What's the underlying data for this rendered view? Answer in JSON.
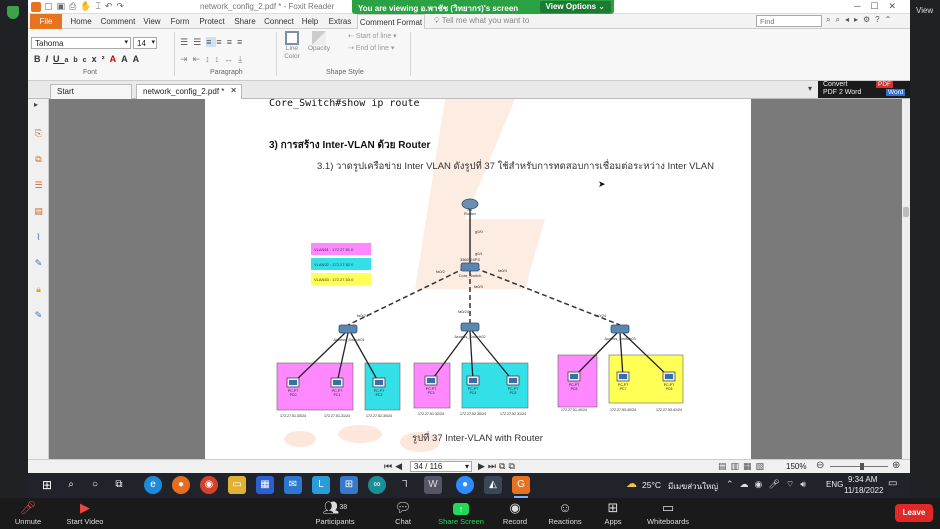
{
  "window": {
    "title": "network_config_2.pdf * - Foxit Reader",
    "right_view_label": "View"
  },
  "zoom_banner": {
    "text": "You are viewing อ.พาชัช (วิทยากร)'s screen",
    "button": "View Options ⌄"
  },
  "ribbon_tabs": [
    "File",
    "Home",
    "Comment",
    "View",
    "Form",
    "Protect",
    "Share",
    "Connect",
    "Help",
    "Extras",
    "Comment Format"
  ],
  "tell_me": "Tell me what you want to",
  "find_placeholder": "Find",
  "font": {
    "family": "Tahoma",
    "size": "14"
  },
  "groups": {
    "font": "Font",
    "paragraph": "Paragraph",
    "shape": "Shape Style"
  },
  "shape_buttons": {
    "line_color": "Line Color",
    "opacity": "Opacity",
    "start": "Start of line",
    "end": "End of line"
  },
  "doc_tabs": [
    {
      "label": "Start"
    },
    {
      "label": "network_config_2.pdf *"
    }
  ],
  "convert_ad": {
    "line1": "Convert",
    "line2": "PDF 2 Word",
    "badge": "PDF",
    "badge2": "Word"
  },
  "pdf": {
    "cmd_line": "Core_Switch#show ip route",
    "heading": "3) การสร้าง Inter-VLAN ด้วย Router",
    "paragraph": "3.1) วาดรูปเครือข่าย Inter VLAN ดังรูปที่ 37 ใช้สำหรับการทดสอบการเชื่อมต่อระหว่าง Inter VLAN",
    "caption": "รูปที่ 37 Inter-VLAN with Router"
  },
  "diagram": {
    "router": {
      "name": "R1",
      "type": "Router"
    },
    "core_switch": {
      "name": "Core_Switch",
      "type": "3560-24PS"
    },
    "access_switches": [
      {
        "name": "Access_Switch01"
      },
      {
        "name": "Access_Switch02"
      },
      {
        "name": "Access_Switch03"
      }
    ],
    "legend": [
      {
        "text": "VLAN51 : 172.27.51.0",
        "color": "#ff88ff"
      },
      {
        "text": "VLAN52 : 172.27.52.0",
        "color": "#33e0e8"
      },
      {
        "text": "VLAN53 : 172.27.53.0",
        "color": "#ffff55"
      }
    ],
    "ports": {
      "router_core": "g0/0",
      "core_top": "g0/1",
      "core_left": "fa0/2",
      "core_right": "fa0/4",
      "core_down": "fa0/3",
      "as1": "fa0/24",
      "as2": "fa0/24",
      "as3": "fa0/24"
    },
    "pcs": [
      {
        "name": "PC0",
        "type": "PC-PT",
        "ip": "172.27.51.30/24",
        "color": "#ff88ff"
      },
      {
        "name": "PC1",
        "type": "PC-PT",
        "ip": "172.27.51.31/24",
        "color": "#ff88ff"
      },
      {
        "name": "PC2",
        "type": "PC-PT",
        "ip": "172.27.52.30/24",
        "color": "#33e0e8"
      },
      {
        "name": "PC3",
        "type": "PC-PT",
        "ip": "172.27.51.32/24",
        "color": "#ff88ff"
      },
      {
        "name": "PC4",
        "type": "PC-PT",
        "ip": "172.27.52.30/24",
        "color": "#33e0e8"
      },
      {
        "name": "PC5",
        "type": "PC-PT",
        "ip": "172.27.52.31/24",
        "color": "#33e0e8"
      },
      {
        "name": "PC6",
        "type": "PC-PT",
        "ip": "172.27.51.40/24",
        "color": "#ff88ff"
      },
      {
        "name": "PC7",
        "type": "PC-PT",
        "ip": "172.27.53.40/24",
        "color": "#ffff55"
      },
      {
        "name": "PC8",
        "type": "PC-PT",
        "ip": "172.27.53.41/24",
        "color": "#ffff55"
      }
    ]
  },
  "statusbar": {
    "page": "34 / 116",
    "zoom": "150%"
  },
  "taskbar": {
    "weather": "25°C",
    "weather_desc": "มีเมฆส่วนใหญ่",
    "lang": "ENG",
    "time": "9:34 AM",
    "date": "11/18/2022"
  },
  "zoom_controls": {
    "unmute": "Unmute",
    "start_video": "Start Video",
    "participants": "Participants",
    "participants_count": "38",
    "chat": "Chat",
    "share_screen": "Share Screen",
    "record": "Record",
    "reactions": "Reactions",
    "apps": "Apps",
    "whiteboards": "Whiteboards",
    "leave": "Leave"
  },
  "colors": {
    "accent": "#e8731f",
    "zoom_leave": "#e02828",
    "share_green": "#23d959",
    "pdf_watermark": "#f4a06a"
  }
}
